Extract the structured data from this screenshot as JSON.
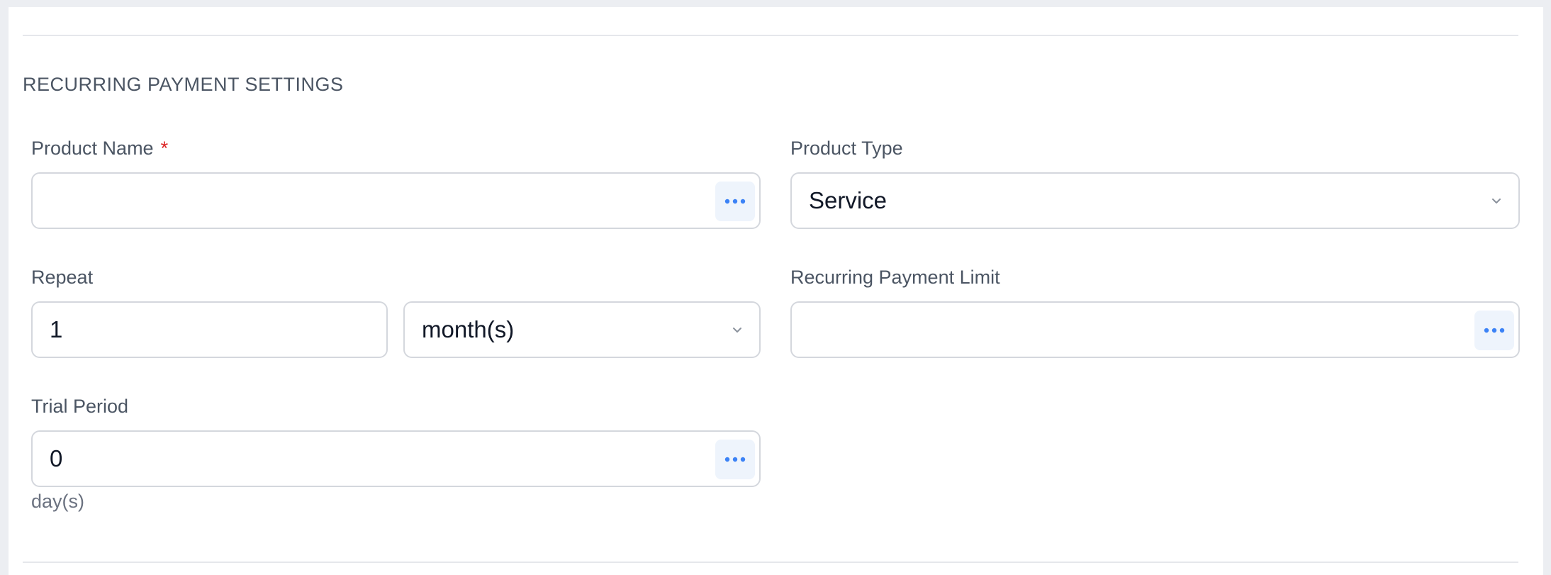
{
  "section": {
    "title": "RECURRING PAYMENT SETTINGS"
  },
  "product_name": {
    "label": "Product Name",
    "required_marker": "*",
    "value": "",
    "action_icon": "more-dots-icon"
  },
  "product_type": {
    "label": "Product Type",
    "selected": "Service",
    "icon": "chevron-down-icon"
  },
  "repeat": {
    "label": "Repeat",
    "count": "1",
    "unit": "month(s)",
    "icon": "chevron-down-icon"
  },
  "recurring_limit": {
    "label": "Recurring Payment Limit",
    "value": "",
    "action_icon": "more-dots-icon"
  },
  "trial": {
    "label": "Trial Period",
    "value": "0",
    "unit_hint": "day(s)",
    "action_icon": "more-dots-icon"
  },
  "colors": {
    "accent": "#3b82f6",
    "required": "#dc2626",
    "border": "#d4d7dd",
    "label": "#4b5563"
  }
}
